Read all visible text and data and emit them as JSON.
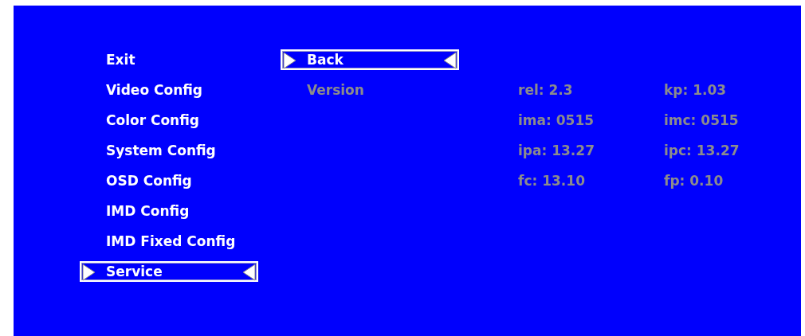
{
  "menu": {
    "items": [
      {
        "label": "Exit",
        "selected": false
      },
      {
        "label": "Video Config",
        "selected": false
      },
      {
        "label": "Color Config",
        "selected": false
      },
      {
        "label": "System Config",
        "selected": false
      },
      {
        "label": "OSD Config",
        "selected": false
      },
      {
        "label": "IMD Config",
        "selected": false
      },
      {
        "label": "IMD Fixed Config",
        "selected": false
      },
      {
        "label": "Service",
        "selected": true
      }
    ]
  },
  "submenu": {
    "items": [
      {
        "label": "Back",
        "selected": true
      }
    ]
  },
  "version": {
    "label": "Version",
    "disabled": true,
    "rows": [
      {
        "left": "rel: 2.3",
        "right": "kp: 1.03"
      },
      {
        "left": "ima: 0515",
        "right": "imc: 0515"
      },
      {
        "left": "ipa: 13.27",
        "right": "ipc: 13.27"
      },
      {
        "left": "fc: 13.10",
        "right": "fp: 0.10"
      }
    ]
  }
}
